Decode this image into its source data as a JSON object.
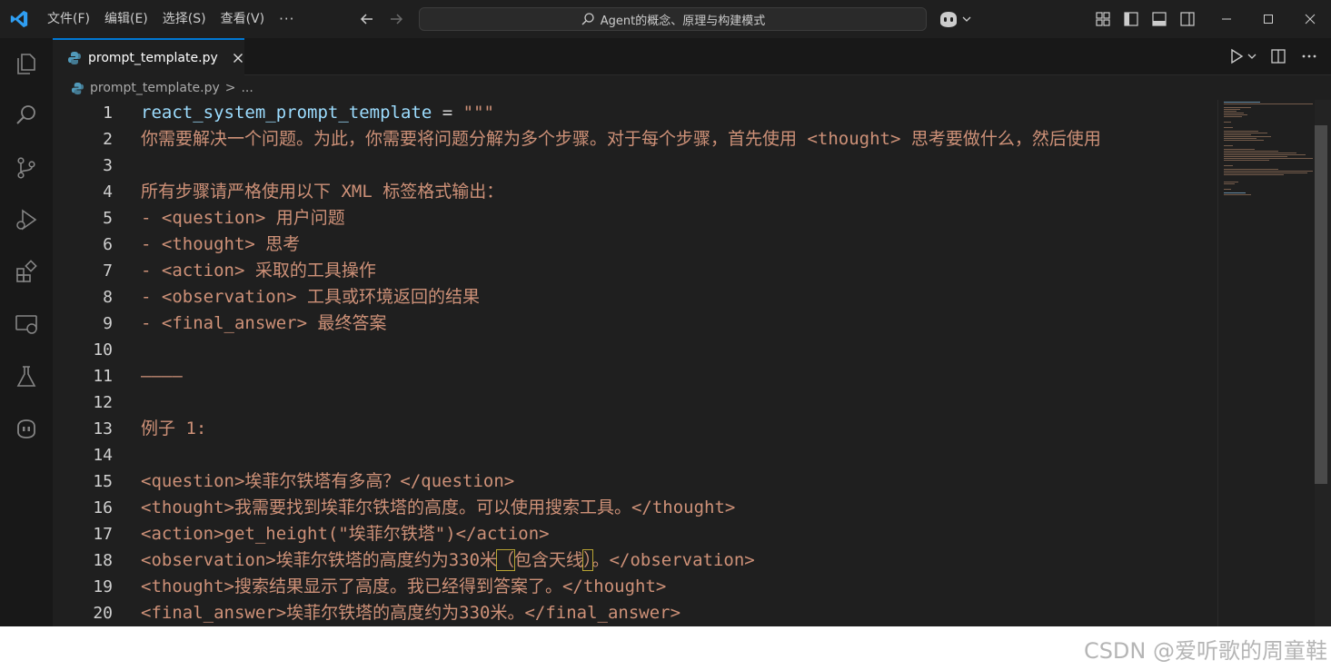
{
  "titlebar": {
    "menu": [
      "文件(F)",
      "编辑(E)",
      "选择(S)",
      "查看(V)"
    ],
    "more": "···",
    "search_text": "Agent的概念、原理与构建模式"
  },
  "tab": {
    "label": "prompt_template.py"
  },
  "breadcrumb": {
    "file": "prompt_template.py",
    "separator": ">",
    "rest": "..."
  },
  "code": {
    "line_numbers": [
      "1",
      "2",
      "3",
      "4",
      "5",
      "6",
      "7",
      "8",
      "9",
      "10",
      "11",
      "12",
      "13",
      "14",
      "15",
      "16",
      "17",
      "18",
      "19",
      "20"
    ],
    "line1": {
      "var": "react_system_prompt_template",
      "op": " = ",
      "str": "\"\"\""
    },
    "lines": [
      "",
      "你需要解决一个问题。为此，你需要将问题分解为多个步骤。对于每个步骤，首先使用 <thought> 思考要做什么，然后使用",
      "",
      "所有步骤请严格使用以下 XML 标签格式输出：",
      "- <question> 用户问题",
      "- <thought> 思考",
      "- <action> 采取的工具操作",
      "- <observation> 工具或环境返回的结果",
      "- <final_answer> 最终答案",
      "",
      "————",
      "",
      "例子 1:",
      "",
      "<question>埃菲尔铁塔有多高？</question>",
      "<thought>我需要找到埃菲尔铁塔的高度。可以使用搜索工具。</thought>",
      "<action>get_height(\"埃菲尔铁塔\")</action>",
      "",
      "<thought>搜索结果显示了高度。我已经得到答案了。</thought>",
      "<final_answer>埃菲尔铁塔的高度约为330米。</final_answer>"
    ],
    "line18": {
      "before": "<observation>埃菲尔铁塔的高度约为330米",
      "open": "（",
      "middle": "包含天线",
      "close": "）",
      "after": "。</observation>"
    }
  },
  "watermark": "CSDN @爱听歌的周童鞋",
  "colors": {
    "editor_bg": "#1f1f1f",
    "string": "#ce9178",
    "variable": "#9cdcfe",
    "accent": "#0078d4"
  }
}
